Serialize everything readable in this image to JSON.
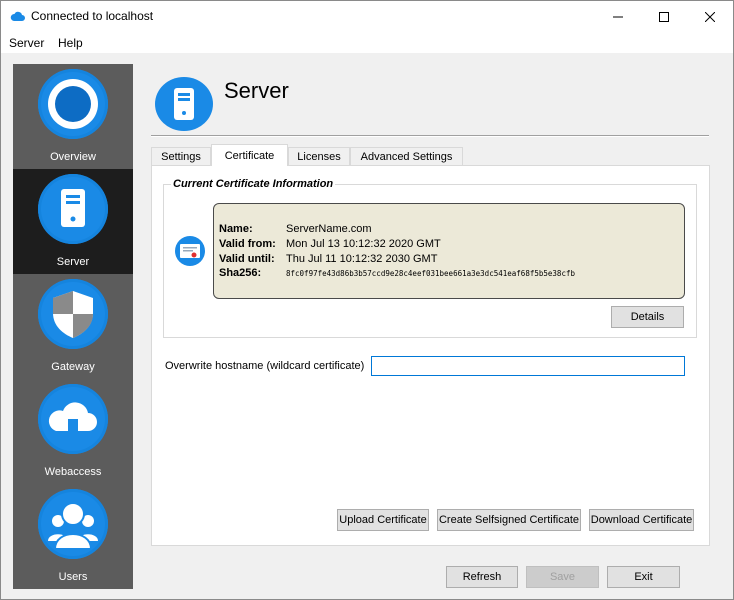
{
  "window": {
    "title": "Connected to localhost"
  },
  "menu": {
    "items": [
      "Server",
      "Help"
    ]
  },
  "sidebar": {
    "items": [
      {
        "label": "Overview",
        "icon": "overview-icon"
      },
      {
        "label": "Server",
        "icon": "server-icon",
        "active": true
      },
      {
        "label": "Gateway",
        "icon": "shield-icon"
      },
      {
        "label": "Webaccess",
        "icon": "cloud-icon"
      },
      {
        "label": "Users",
        "icon": "users-icon"
      }
    ]
  },
  "page": {
    "title": "Server"
  },
  "tabs": [
    {
      "label": "Settings"
    },
    {
      "label": "Certificate",
      "active": true
    },
    {
      "label": "Licenses"
    },
    {
      "label": "Advanced Settings"
    }
  ],
  "certificate": {
    "group_title": "Current Certificate Information",
    "name_label": "Name:",
    "name": "ServerName.com",
    "valid_from_label": "Valid from:",
    "valid_from": "Mon Jul 13 10:12:32 2020 GMT",
    "valid_until_label": "Valid until:",
    "valid_until": "Thu Jul 11 10:12:32 2030 GMT",
    "sha_label": "Sha256:",
    "sha256": "8fc0f97fe43d86b3b57ccd9e28c4eef031bee661a3e3dc541eaf68f5b5e38cfb",
    "details_button": "Details"
  },
  "overwrite": {
    "label": "Overwrite hostname (wildcard certificate)",
    "value": ""
  },
  "actions": {
    "upload": "Upload Certificate",
    "create_selfsigned": "Create Selfsigned Certificate",
    "download": "Download Certificate"
  },
  "footer": {
    "refresh": "Refresh",
    "save": "Save",
    "exit": "Exit"
  },
  "colors": {
    "accent": "#1a8ae6",
    "sidebar_bg": "#5c5c5c",
    "sidebar_active": "#1d1d1d",
    "cert_box": "#ece9d8"
  }
}
